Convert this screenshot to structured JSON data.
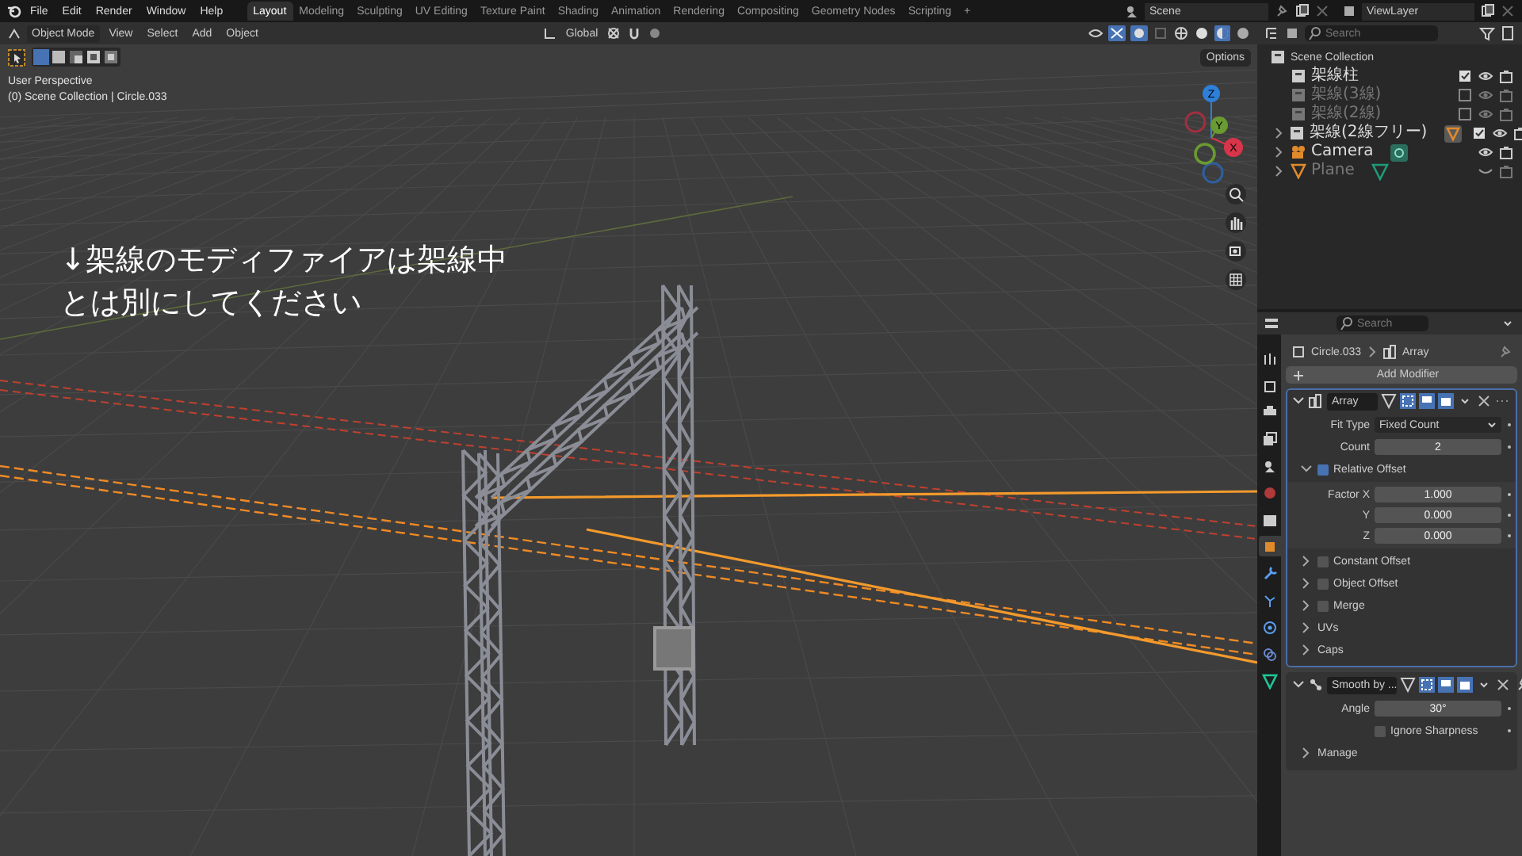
{
  "menu": [
    "File",
    "Edit",
    "Render",
    "Window",
    "Help"
  ],
  "workspaces": [
    {
      "label": "Layout",
      "selected": true
    },
    {
      "label": "Modeling",
      "selected": false
    },
    {
      "label": "Sculpting",
      "selected": false
    },
    {
      "label": "UV Editing",
      "selected": false
    },
    {
      "label": "Texture Paint",
      "selected": false
    },
    {
      "label": "Shading",
      "selected": false
    },
    {
      "label": "Animation",
      "selected": false
    },
    {
      "label": "Rendering",
      "selected": false
    },
    {
      "label": "Compositing",
      "selected": false
    },
    {
      "label": "Geometry Nodes",
      "selected": false
    },
    {
      "label": "Scripting",
      "selected": false
    }
  ],
  "add_workspace": "+",
  "scene": "Scene",
  "view_layer": "ViewLayer",
  "viewport": {
    "mode": "Object Mode",
    "menus": [
      "View",
      "Select",
      "Add",
      "Object"
    ],
    "orientation": "Global",
    "options": "Options",
    "view_name": "User Perspective",
    "context": "(0) Scene Collection | Circle.033",
    "annotation": [
      "↓架線のモディファイアは架線中",
      "とは別にしてください"
    ],
    "gizmo_axes": [
      "X",
      "Y",
      "Z"
    ]
  },
  "outliner": {
    "search": {
      "placeholder": "Search"
    },
    "root": "Scene Collection",
    "items": [
      {
        "name": "架線柱",
        "kind": "collection",
        "checked": true,
        "visible": true,
        "expandable": false
      },
      {
        "name": "架線(3線)",
        "kind": "collection",
        "checked": false,
        "visible": true,
        "expandable": false
      },
      {
        "name": "架線(2線)",
        "kind": "collection",
        "checked": false,
        "visible": true,
        "expandable": false
      },
      {
        "name": "架線(2線フリー)",
        "kind": "collection",
        "checked": true,
        "visible": true,
        "expandable": true
      },
      {
        "name": "Camera",
        "kind": "camera",
        "visible": true,
        "expandable": true
      },
      {
        "name": "Plane",
        "kind": "mesh",
        "visible": false,
        "expandable": true
      }
    ]
  },
  "properties": {
    "search": {
      "placeholder": "Search"
    },
    "tabs": [
      {
        "selected": false
      },
      {
        "selected": false
      },
      {
        "selected": false
      },
      {
        "selected": false
      },
      {
        "selected": false
      },
      {
        "selected": false
      },
      {
        "selected": false
      },
      {
        "selected": true
      },
      {
        "selected": false
      },
      {
        "selected": false
      },
      {
        "selected": false
      },
      {
        "selected": false
      },
      {
        "selected": false
      }
    ],
    "breadcrumb": [
      "Circle.033",
      "Array"
    ],
    "add_modifier": "Add Modifier",
    "modifiers": [
      {
        "name": "Array",
        "expanded": true,
        "active": true,
        "fields": [
          {
            "kind": "dropdown",
            "label": "Fit Type",
            "value": "Fixed Count"
          },
          {
            "kind": "number",
            "label": "Count",
            "value": "2"
          }
        ],
        "sections": [
          {
            "kind": "toggle",
            "label": "Relative Offset",
            "checked": true,
            "expanded": true,
            "fields": [
              {
                "kind": "number",
                "label": "Factor X",
                "value": "1.000"
              },
              {
                "kind": "number",
                "label": "Y",
                "value": "0.000"
              },
              {
                "kind": "number",
                "label": "Z",
                "value": "0.000"
              }
            ]
          },
          {
            "kind": "toggle",
            "label": "Constant Offset",
            "checked": false,
            "expanded": false
          },
          {
            "kind": "toggle",
            "label": "Object Offset",
            "checked": false,
            "expanded": false
          },
          {
            "kind": "toggle",
            "label": "Merge",
            "checked": false,
            "expanded": false
          },
          {
            "kind": "plain",
            "label": "UVs",
            "expanded": false
          },
          {
            "kind": "plain",
            "label": "Caps",
            "expanded": false
          }
        ]
      },
      {
        "name": "Smooth by ...",
        "expanded": true,
        "active": false,
        "fields": [
          {
            "kind": "number",
            "label": "Angle",
            "value": "30°"
          },
          {
            "kind": "checkbox",
            "label": "Ignore Sharpness",
            "checked": false
          }
        ],
        "sections": [
          {
            "kind": "plain",
            "label": "Manage",
            "expanded": false
          }
        ]
      }
    ]
  }
}
